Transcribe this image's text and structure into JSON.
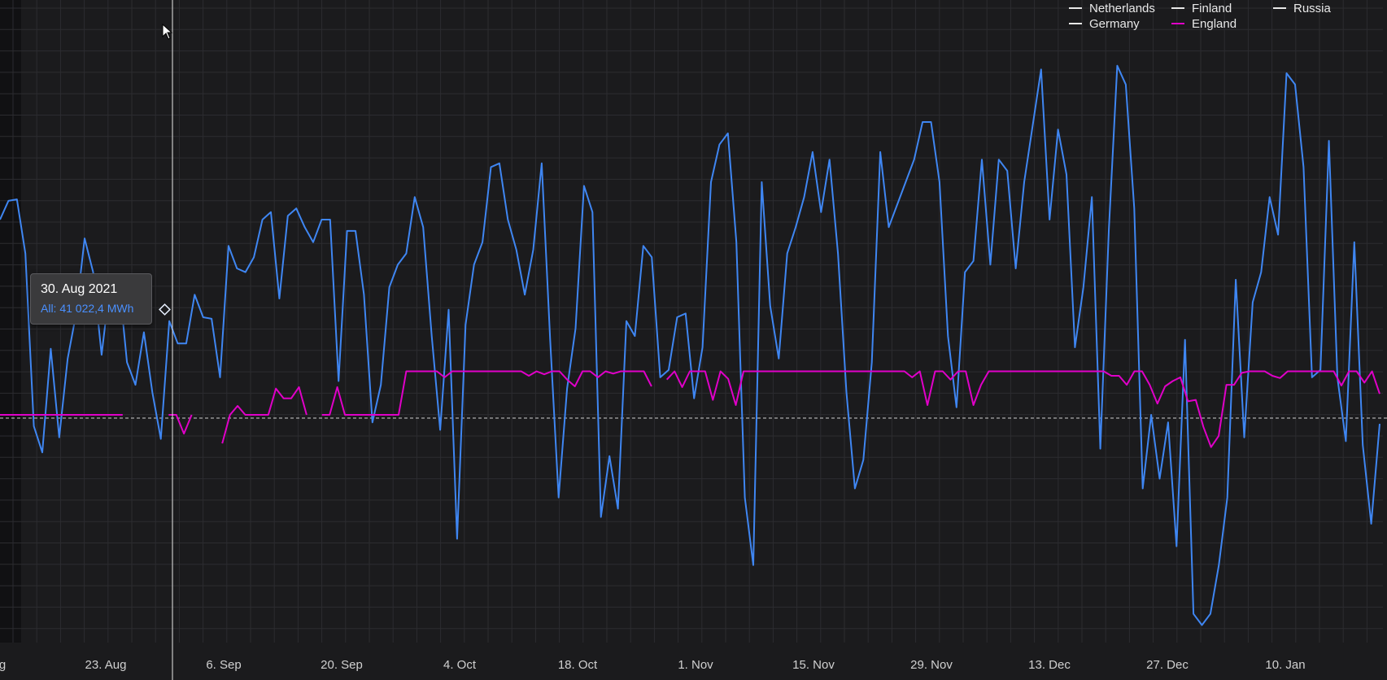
{
  "chart_data": {
    "type": "line",
    "x_axis": {
      "ticks": [
        "g",
        "23. Aug",
        "6. Sep",
        "20. Sep",
        "4. Oct",
        "18. Oct",
        "1. Nov",
        "15. Nov",
        "29. Nov",
        "13. Dec",
        "27. Dec",
        "10. Jan"
      ]
    },
    "ylim": [
      -30000,
      52000
    ],
    "zero_line": 0,
    "grid": true,
    "legend": {
      "placement": "top-right",
      "items": [
        {
          "name": "Netherlands",
          "color": "#e8e8e8"
        },
        {
          "name": "Finland",
          "color": "#e8e8e8"
        },
        {
          "name": "Russia",
          "color": "#e8e8e8"
        },
        {
          "name": "Germany",
          "color": "#e8e8e8"
        },
        {
          "name": "England",
          "color": "#e000c8"
        }
      ]
    },
    "series": [
      {
        "name": "All",
        "color": "#3f86f2",
        "values": [
          26000,
          28500,
          28700,
          21500,
          -1500,
          -5000,
          8800,
          -3000,
          7500,
          13500,
          23500,
          19000,
          8000,
          17500,
          18500,
          7000,
          4000,
          11000,
          3000,
          -3200,
          12500,
          9500,
          9500,
          16000,
          13000,
          12800,
          5000,
          22500,
          19500,
          19000,
          21000,
          26000,
          27000,
          15500,
          26500,
          27500,
          25000,
          23000,
          26000,
          26000,
          4500,
          24500,
          24500,
          16000,
          -1000,
          4000,
          17000,
          20000,
          21500,
          29000,
          25000,
          10500,
          -2000,
          14000,
          -16500,
          12000,
          20000,
          23000,
          33000,
          33500,
          26000,
          22000,
          16000,
          22000,
          33500,
          10000,
          -11000,
          3500,
          11500,
          30500,
          27000,
          -13600,
          -5500,
          -12500,
          12500,
          10500,
          22500,
          21000,
          5000,
          6000,
          13000,
          13500,
          2200,
          9000,
          31000,
          36000,
          37500,
          23000,
          -11000,
          -20000,
          31000,
          14500,
          7500,
          21500,
          25000,
          29000,
          35000,
          27000,
          34000,
          21500,
          3000,
          -9800,
          -6000,
          7000,
          35000,
          25000,
          28000,
          31000,
          34000,
          39000,
          39000,
          31000,
          10500,
          1000,
          19000,
          20500,
          34000,
          20000,
          34000,
          32500,
          19500,
          31000,
          38500,
          46000,
          26000,
          38000,
          32000,
          9000,
          17000,
          29000,
          -4500,
          24500,
          46500,
          44000,
          27500,
          -9800,
          0,
          -8500,
          -1000,
          -17500,
          10000,
          -26500,
          -28000,
          -26500,
          -20000,
          -11000,
          18000,
          -3000,
          15000,
          19000,
          29000,
          24000,
          45500,
          44000,
          33000,
          5000,
          6000,
          36500,
          5000,
          -3500,
          23000,
          -4000,
          -14500,
          -1200
        ]
      },
      {
        "name": "England",
        "color": "#e000c8",
        "values": [
          0,
          0,
          0,
          0,
          0,
          0,
          0,
          0,
          0,
          0,
          0,
          0,
          0,
          0,
          0,
          0,
          0,
          null,
          null,
          null,
          null,
          null,
          0,
          0,
          -2500,
          0,
          null,
          null,
          null,
          -3800,
          0,
          1200,
          0,
          0,
          0,
          0,
          3500,
          2200,
          2200,
          3700,
          0,
          null,
          0,
          0,
          3700,
          0,
          0,
          0,
          0,
          0,
          0,
          0,
          0,
          5800,
          5800,
          5800,
          5800,
          5800,
          5000,
          5800,
          5800,
          5800,
          5800,
          5800,
          5800,
          5800,
          5800,
          5800,
          5800,
          5200,
          5800,
          5400,
          5800,
          5800,
          4700,
          3800,
          5800,
          5800,
          5000,
          5800,
          5500,
          5800,
          5800,
          5800,
          5800,
          3800,
          null,
          4700,
          5800,
          3700,
          5800,
          5800,
          5800,
          2000,
          5800,
          4800,
          1300,
          5800,
          5800,
          5800,
          5800,
          5800,
          5800,
          5800,
          5800,
          5800,
          5800,
          5800,
          5800,
          5800,
          5800,
          5800,
          5800,
          5800,
          5800,
          5800,
          5800,
          5800,
          5800,
          5000,
          5800,
          1300,
          5800,
          5800,
          4700,
          5800,
          5800,
          1300,
          4000,
          5800,
          5800,
          5800,
          5800,
          5800,
          5800,
          5800,
          5800,
          5800,
          5800,
          5800,
          5800,
          5800,
          5800,
          5800,
          5800,
          5200,
          5200,
          4000,
          5800,
          5800,
          4000,
          1500,
          3800,
          4500,
          5000,
          1800,
          2000,
          -1600,
          -4300,
          -2800,
          4000,
          4000,
          5600,
          5800,
          5800,
          5800,
          5200,
          4900,
          5800,
          5800,
          5800,
          5800,
          5800,
          5800,
          5800,
          3900,
          5800,
          5800,
          4300,
          5800,
          2800
        ]
      }
    ]
  },
  "tooltip": {
    "date": "30. Aug 2021",
    "series_line": "All: 41 022,4 MWh"
  },
  "cursor_icon": "mouse-pointer-icon"
}
